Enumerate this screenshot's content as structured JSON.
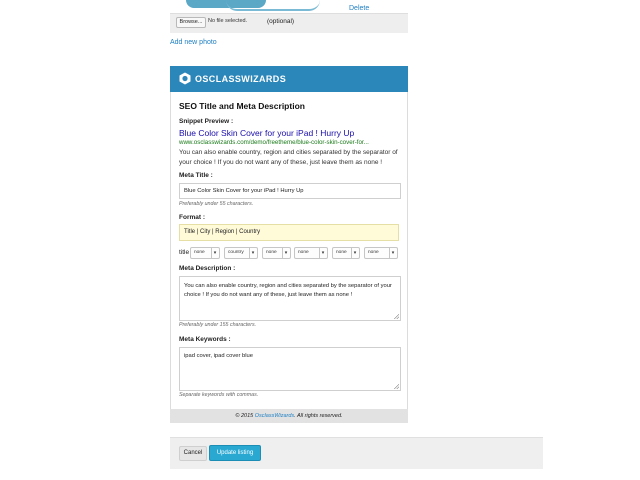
{
  "photo": {
    "delete_label": "Delete",
    "browse_label": "Browse...",
    "file_status": "No file selected.",
    "optional_label": "(optional)",
    "add_photo_label": "Add new photo"
  },
  "plugin": {
    "brand": "OSCLASSWIZARDS",
    "header_color": "#2b86b9",
    "title": "SEO Title and Meta Description",
    "snippet": {
      "label": "Snippet Preview :",
      "title": "Blue Color Skin Cover for your iPad ! Hurry Up",
      "url": "www.osclasswizards.com/demo/freetheme/blue-color-skin-cover-for...",
      "description": "You can also enable country, region and cities separated by the separator of your choice ! If you do not want any of these, just leave them as none !"
    },
    "meta_title": {
      "label": "Meta Title :",
      "value": "Blue Color Skin Cover for your iPad !  Hurry Up",
      "hint": "Preferably under 55 characters."
    },
    "format": {
      "label": "Format :",
      "value": "Title | City | Region | Country",
      "row_label": "title",
      "selects": [
        "none",
        "country",
        "none",
        "none",
        "none",
        "none"
      ]
    },
    "meta_description": {
      "label": "Meta Description :",
      "value": "You can also enable country, region and cities separated by the separator of your choice ! If you do not want any of these, just leave them as none !",
      "hint": "Preferably under 155 characters."
    },
    "meta_keywords": {
      "label": "Meta Keywords :",
      "value": "ipad cover, ipad cover blue",
      "hint": "Separate keywords with commas."
    },
    "footer": {
      "prefix": "© 2015 ",
      "link": "OsclassWizards",
      "suffix": ". All rights reserved."
    }
  },
  "actions": {
    "cancel_label": "Cancel",
    "update_label": "Update listing",
    "primary_color": "#29a8d2"
  }
}
